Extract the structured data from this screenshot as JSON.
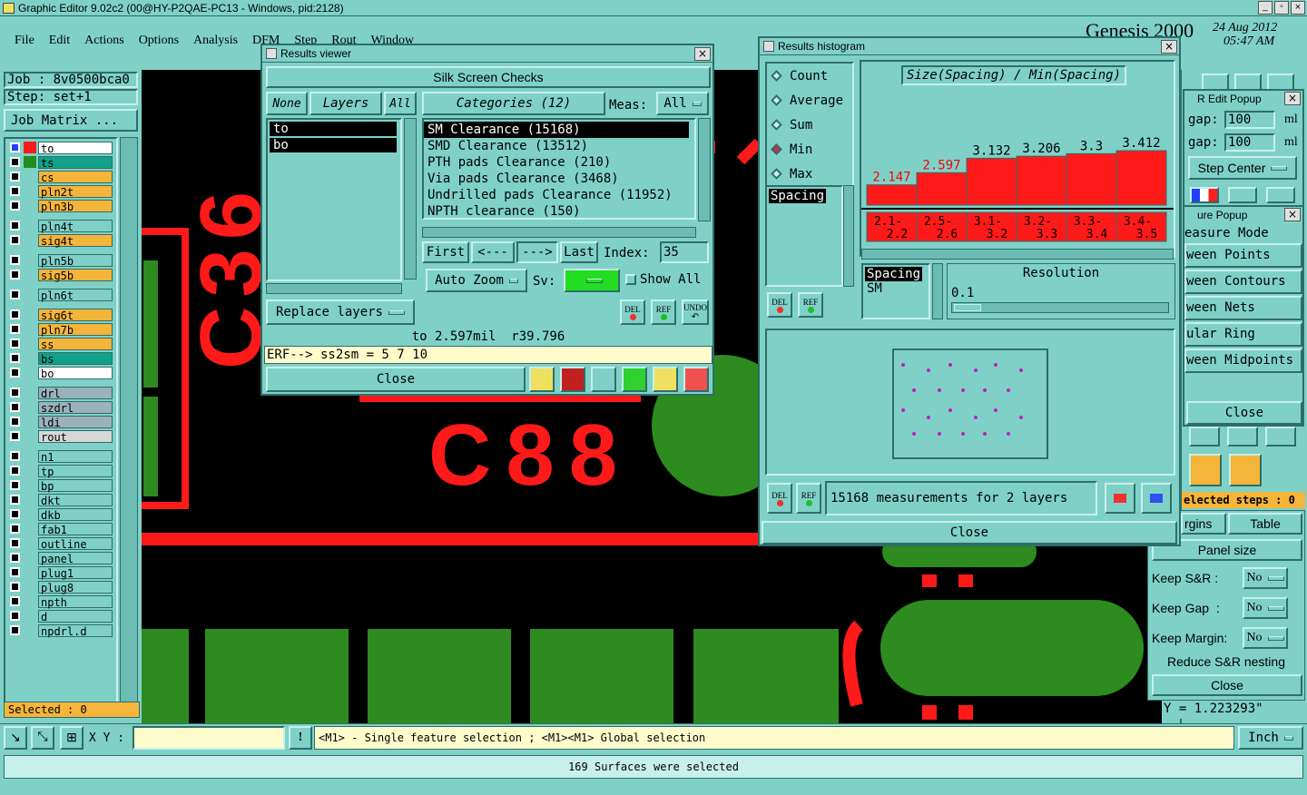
{
  "app": {
    "title": "Graphic Editor 9.02c2 (00@HY-P2QAE-PC13 - Windows, pid:2128)",
    "brand": "Genesis 2000",
    "date": "24 Aug 2012",
    "time": "05:47 AM"
  },
  "menu": [
    "File",
    "Edit",
    "Actions",
    "Options",
    "Analysis",
    "DFM",
    "Step",
    "Rout",
    "Window"
  ],
  "job": {
    "job_label": "Job : 8v0500bca0",
    "step_label": "Step: set+1",
    "matrix_button": "Job Matrix ..."
  },
  "layers": [
    {
      "name": "to",
      "color": "#ff1a1a",
      "bg": "#ffffff",
      "x": true
    },
    {
      "name": "ts",
      "color": "#1f8f1f",
      "bg": "#12a08a"
    },
    {
      "name": "cs",
      "color": "",
      "bg": "#f5b43a"
    },
    {
      "name": "pln2t",
      "color": "",
      "bg": "#f5b43a"
    },
    {
      "name": "pln3b",
      "color": "",
      "bg": "#f5b43a"
    },
    {
      "name": "pln4t",
      "color": "",
      "bg": "#7fd1c8"
    },
    {
      "name": "sig4t",
      "color": "",
      "bg": "#f5b43a"
    },
    {
      "name": "pln5b",
      "color": "",
      "bg": "#7fd1c8"
    },
    {
      "name": "sig5b",
      "color": "",
      "bg": "#f5b43a"
    },
    {
      "name": "pln6t",
      "color": "",
      "bg": "#7fd1c8"
    },
    {
      "name": "sig6t",
      "color": "",
      "bg": "#f5b43a"
    },
    {
      "name": "pln7b",
      "color": "",
      "bg": "#f5b43a"
    },
    {
      "name": "ss",
      "color": "",
      "bg": "#f5b43a"
    },
    {
      "name": "bs",
      "color": "",
      "bg": "#12a08a"
    },
    {
      "name": "bo",
      "color": "",
      "bg": "#ffffff"
    },
    {
      "name": "drl",
      "color": "",
      "bg": "#9ab2ba"
    },
    {
      "name": "szdrl",
      "color": "",
      "bg": "#9ab2ba"
    },
    {
      "name": "ldi",
      "color": "",
      "bg": "#9ab2ba"
    },
    {
      "name": "rout",
      "color": "",
      "bg": "#d8d8d8"
    },
    {
      "name": "n1",
      "color": "",
      "bg": "#7fd1c8"
    },
    {
      "name": "tp",
      "color": "",
      "bg": "#7fd1c8"
    },
    {
      "name": "bp",
      "color": "",
      "bg": "#7fd1c8"
    },
    {
      "name": "dkt",
      "color": "",
      "bg": "#7fd1c8"
    },
    {
      "name": "dkb",
      "color": "",
      "bg": "#7fd1c8"
    },
    {
      "name": "fab1",
      "color": "",
      "bg": "#7fd1c8"
    },
    {
      "name": "outline",
      "color": "",
      "bg": "#7fd1c8"
    },
    {
      "name": "panel",
      "color": "",
      "bg": "#7fd1c8"
    },
    {
      "name": "plug1",
      "color": "",
      "bg": "#7fd1c8"
    },
    {
      "name": "plug8",
      "color": "",
      "bg": "#7fd1c8"
    },
    {
      "name": "npth",
      "color": "",
      "bg": "#7fd1c8"
    },
    {
      "name": "d",
      "color": "",
      "bg": "#7fd1c8"
    },
    {
      "name": "npdrl.d",
      "color": "",
      "bg": "#7fd1c8"
    }
  ],
  "selected": "Selected : 0",
  "canvas": {
    "text_c88": "C88",
    "text_c36": "C36"
  },
  "results_viewer": {
    "title": "Results viewer",
    "header": "Silk Screen Checks",
    "none": "None",
    "layers": "Layers",
    "all": "All",
    "layer_list": [
      "to",
      "bo"
    ],
    "categories": "Categories (12)",
    "meas_label": "Meas:",
    "meas_value": "All",
    "category_items": [
      "SM Clearance (15168)",
      "SMD Clearance (13512)",
      "PTH pads Clearance (210)",
      "Via pads Clearance (3468)",
      "Undrilled pads Clearance (11952)",
      "NPTH clearance (150)"
    ],
    "first": "First",
    "prev": "<---",
    "next": "--->",
    "last": "Last",
    "index_label": "Index:",
    "index_value": "35",
    "auto_zoom": "Auto Zoom",
    "sv_label": "Sv:",
    "show_all": "Show All",
    "replace_layers": "Replace layers",
    "del": "DEL",
    "ref": "REF",
    "undo": "UNDO",
    "status": "to 2.597mil  r39.796",
    "erf": "ERF--> ss2sm = 5 7 10",
    "close": "Close"
  },
  "histogram": {
    "title": "Results histogram",
    "modes": [
      "Count",
      "Average",
      "Sum",
      "Min",
      "Max"
    ],
    "selected_mode": "Min",
    "chart_title": "Size(Spacing) / Min(Spacing)",
    "list1": [
      "Spacing"
    ],
    "list2": [
      "Spacing",
      "SM"
    ],
    "resolution_label": "Resolution",
    "resolution_value": "0.1",
    "measurements": "15168 measurements for 2 layers",
    "close": "Close",
    "del": "DEL",
    "ref": "REF"
  },
  "chart_data": {
    "type": "bar",
    "title": "Size(Spacing) / Min(Spacing)",
    "categories": [
      "2.1-2.2",
      "2.5-2.6",
      "3.1-3.2",
      "3.2-3.3",
      "3.3-3.4",
      "3.4-3.5"
    ],
    "category_lines": [
      [
        "2.1-",
        "2.2"
      ],
      [
        "2.5-",
        "2.6"
      ],
      [
        "3.1-",
        "3.2"
      ],
      [
        "3.2-",
        "3.3"
      ],
      [
        "3.3-",
        "3.4"
      ],
      [
        "3.4-",
        "3.5"
      ]
    ],
    "values": [
      2.147,
      2.597,
      3.132,
      3.206,
      3.3,
      3.412
    ],
    "value_labels": [
      "2.147",
      "2.597",
      "3.132",
      "3.206",
      "3.3",
      "3.412"
    ],
    "label_colors": [
      "#ff0000",
      "#ff0000",
      "#000000",
      "#000000",
      "#000000",
      "#000000"
    ],
    "bar_color": "#ff1a1a"
  },
  "right_panel": {
    "edit_popup": "R Edit Popup",
    "gap1_label": "gap:",
    "gap1": "100",
    "gap2_label": "gap:",
    "gap2": "100",
    "unit": "ml",
    "step_center": "Step Center",
    "measure_popup": "ure Popup",
    "measure_items": [
      "easure Mode",
      "ween Points",
      "ween Contours",
      "ween Nets",
      "ular Ring",
      "ween Midpoints"
    ],
    "close": "Close",
    "selected_steps": "elected steps : 0",
    "margins": "rgins",
    "table": "Table",
    "panel_size": "Panel size",
    "keep_sr": "Keep S&R :",
    "keep_sr_v": "No",
    "keep_gap": "Keep Gap  :",
    "keep_gap_v": "No",
    "keep_margin": "Keep Margin:",
    "keep_margin_v": "No",
    "reduce": "Reduce S&R nesting",
    "close2": "Close",
    "y_readout": "Y = 1.223293\""
  },
  "bottom": {
    "xy_label": "X Y :",
    "hint": "<M1> - Single feature selection ; <M1><M1> Global selection",
    "unit": "Inch",
    "status": "169 Surfaces were selected"
  }
}
